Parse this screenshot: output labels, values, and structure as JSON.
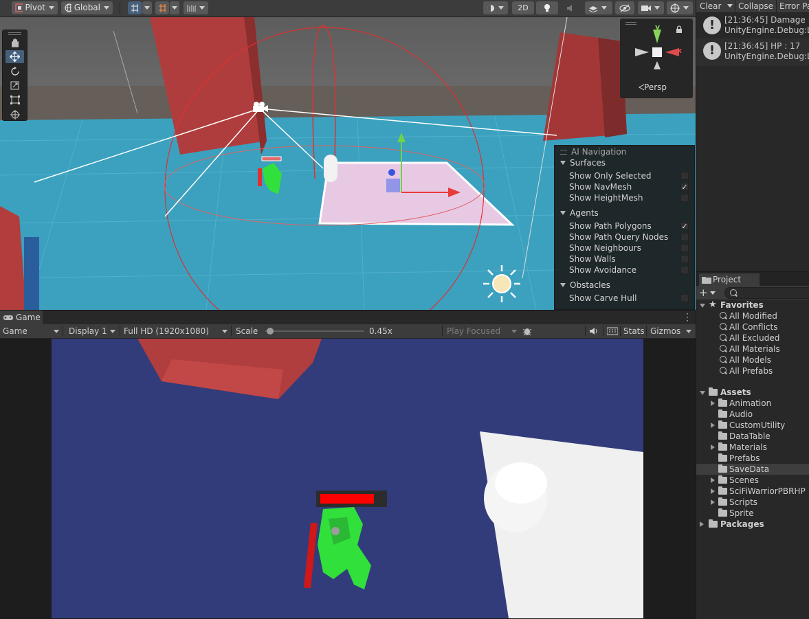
{
  "scene_toolbar": {
    "pivot": "Pivot",
    "global": "Global",
    "mode_2d": "2D"
  },
  "gizmo": {
    "axis_y": "y",
    "axis_x": "x",
    "projection": "Persp"
  },
  "ai_navigation": {
    "title": "AI Navigation",
    "sections": [
      {
        "title": "Surfaces",
        "items": [
          {
            "label": "Show Only Selected",
            "checked": false
          },
          {
            "label": "Show NavMesh",
            "checked": true
          },
          {
            "label": "Show HeightMesh",
            "checked": false
          }
        ]
      },
      {
        "title": "Agents",
        "items": [
          {
            "label": "Show Path Polygons",
            "checked": true
          },
          {
            "label": "Show Path Query Nodes",
            "checked": false
          },
          {
            "label": "Show Neighbours",
            "checked": false
          },
          {
            "label": "Show Walls",
            "checked": false
          },
          {
            "label": "Show Avoidance",
            "checked": false
          }
        ]
      },
      {
        "title": "Obstacles",
        "items": [
          {
            "label": "Show Carve Hull",
            "checked": false
          }
        ]
      }
    ]
  },
  "game_tab": {
    "title": "Game"
  },
  "game_toolbar": {
    "view": "Game",
    "display": "Display 1",
    "resolution": "Full HD (1920x1080)",
    "scale_label": "Scale",
    "scale_value": "0.45x",
    "scale_fraction": 0.05,
    "play_focused": "Play Focused",
    "stats": "Stats",
    "gizmos": "Gizmos"
  },
  "console": {
    "clear": "Clear",
    "collapse": "Collapse",
    "error_pause": "Error Pa",
    "entries": [
      {
        "line1": "[21:36:45] Damage : 3",
        "line2": "UnityEngine.Debug:Lo"
      },
      {
        "line1": "[21:36:45] HP : 17",
        "line2": "UnityEngine.Debug:Lo"
      }
    ]
  },
  "project": {
    "tab": "Project",
    "favorites_label": "Favorites",
    "favorites": [
      "All Modified",
      "All Conflicts",
      "All Excluded",
      "All Materials",
      "All Models",
      "All Prefabs"
    ],
    "assets_label": "Assets",
    "assets": [
      {
        "name": "Animation",
        "expandable": true
      },
      {
        "name": "Audio",
        "expandable": false
      },
      {
        "name": "CustomUtility",
        "expandable": true
      },
      {
        "name": "DataTable",
        "expandable": false
      },
      {
        "name": "Materials",
        "expandable": true
      },
      {
        "name": "Prefabs",
        "expandable": false
      },
      {
        "name": "SaveData",
        "expandable": false,
        "selected": true
      },
      {
        "name": "Scenes",
        "expandable": true
      },
      {
        "name": "SciFiWarriorPBRHP",
        "expandable": true
      },
      {
        "name": "Scripts",
        "expandable": true
      },
      {
        "name": "Sprite",
        "expandable": false
      }
    ],
    "packages_label": "Packages"
  },
  "colors": {
    "accent": "#46607c",
    "ground": "#3ba1bf",
    "game_floor": "#323c7a",
    "obstacle_red": "#b83e3e",
    "health_red": "#ff0000"
  }
}
